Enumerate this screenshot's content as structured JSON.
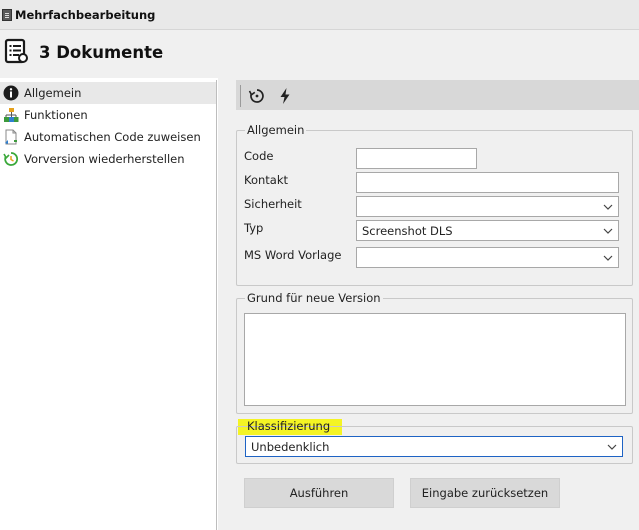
{
  "window": {
    "title": "Mehrfachbearbeitung"
  },
  "header": {
    "title": "3 Dokumente"
  },
  "sidebar": {
    "items": [
      {
        "label": "Allgemein",
        "icon": "info-icon",
        "active": true
      },
      {
        "label": "Funktionen",
        "icon": "hierarchy-icon",
        "active": false
      },
      {
        "label": "Automatischen Code zuweisen",
        "icon": "document-code-icon",
        "active": false
      },
      {
        "label": "Vorversion wiederherstellen",
        "icon": "restore-icon",
        "active": false
      }
    ]
  },
  "toolbar": {
    "buttons": [
      "reset-icon",
      "lightning-icon"
    ]
  },
  "general": {
    "legend": "Allgemein",
    "code_label": "Code",
    "code_value": "",
    "kontakt_label": "Kontakt",
    "kontakt_value": "",
    "sicherheit_label": "Sicherheit",
    "sicherheit_value": "",
    "typ_label": "Typ",
    "typ_value": "Screenshot DLS",
    "word_label": "MS Word Vorlage",
    "word_value": ""
  },
  "reason": {
    "legend": "Grund für neue Version",
    "value": ""
  },
  "classification": {
    "legend": "Klassifizierung",
    "value": "Unbedenklich"
  },
  "actions": {
    "execute": "Ausführen",
    "reset": "Eingabe zurücksetzen"
  },
  "colors": {
    "accent_border": "#1e63c4",
    "highlight": "#f4f500",
    "button_bg": "#d9d9d9",
    "panel_bg": "#f0f0f0"
  }
}
